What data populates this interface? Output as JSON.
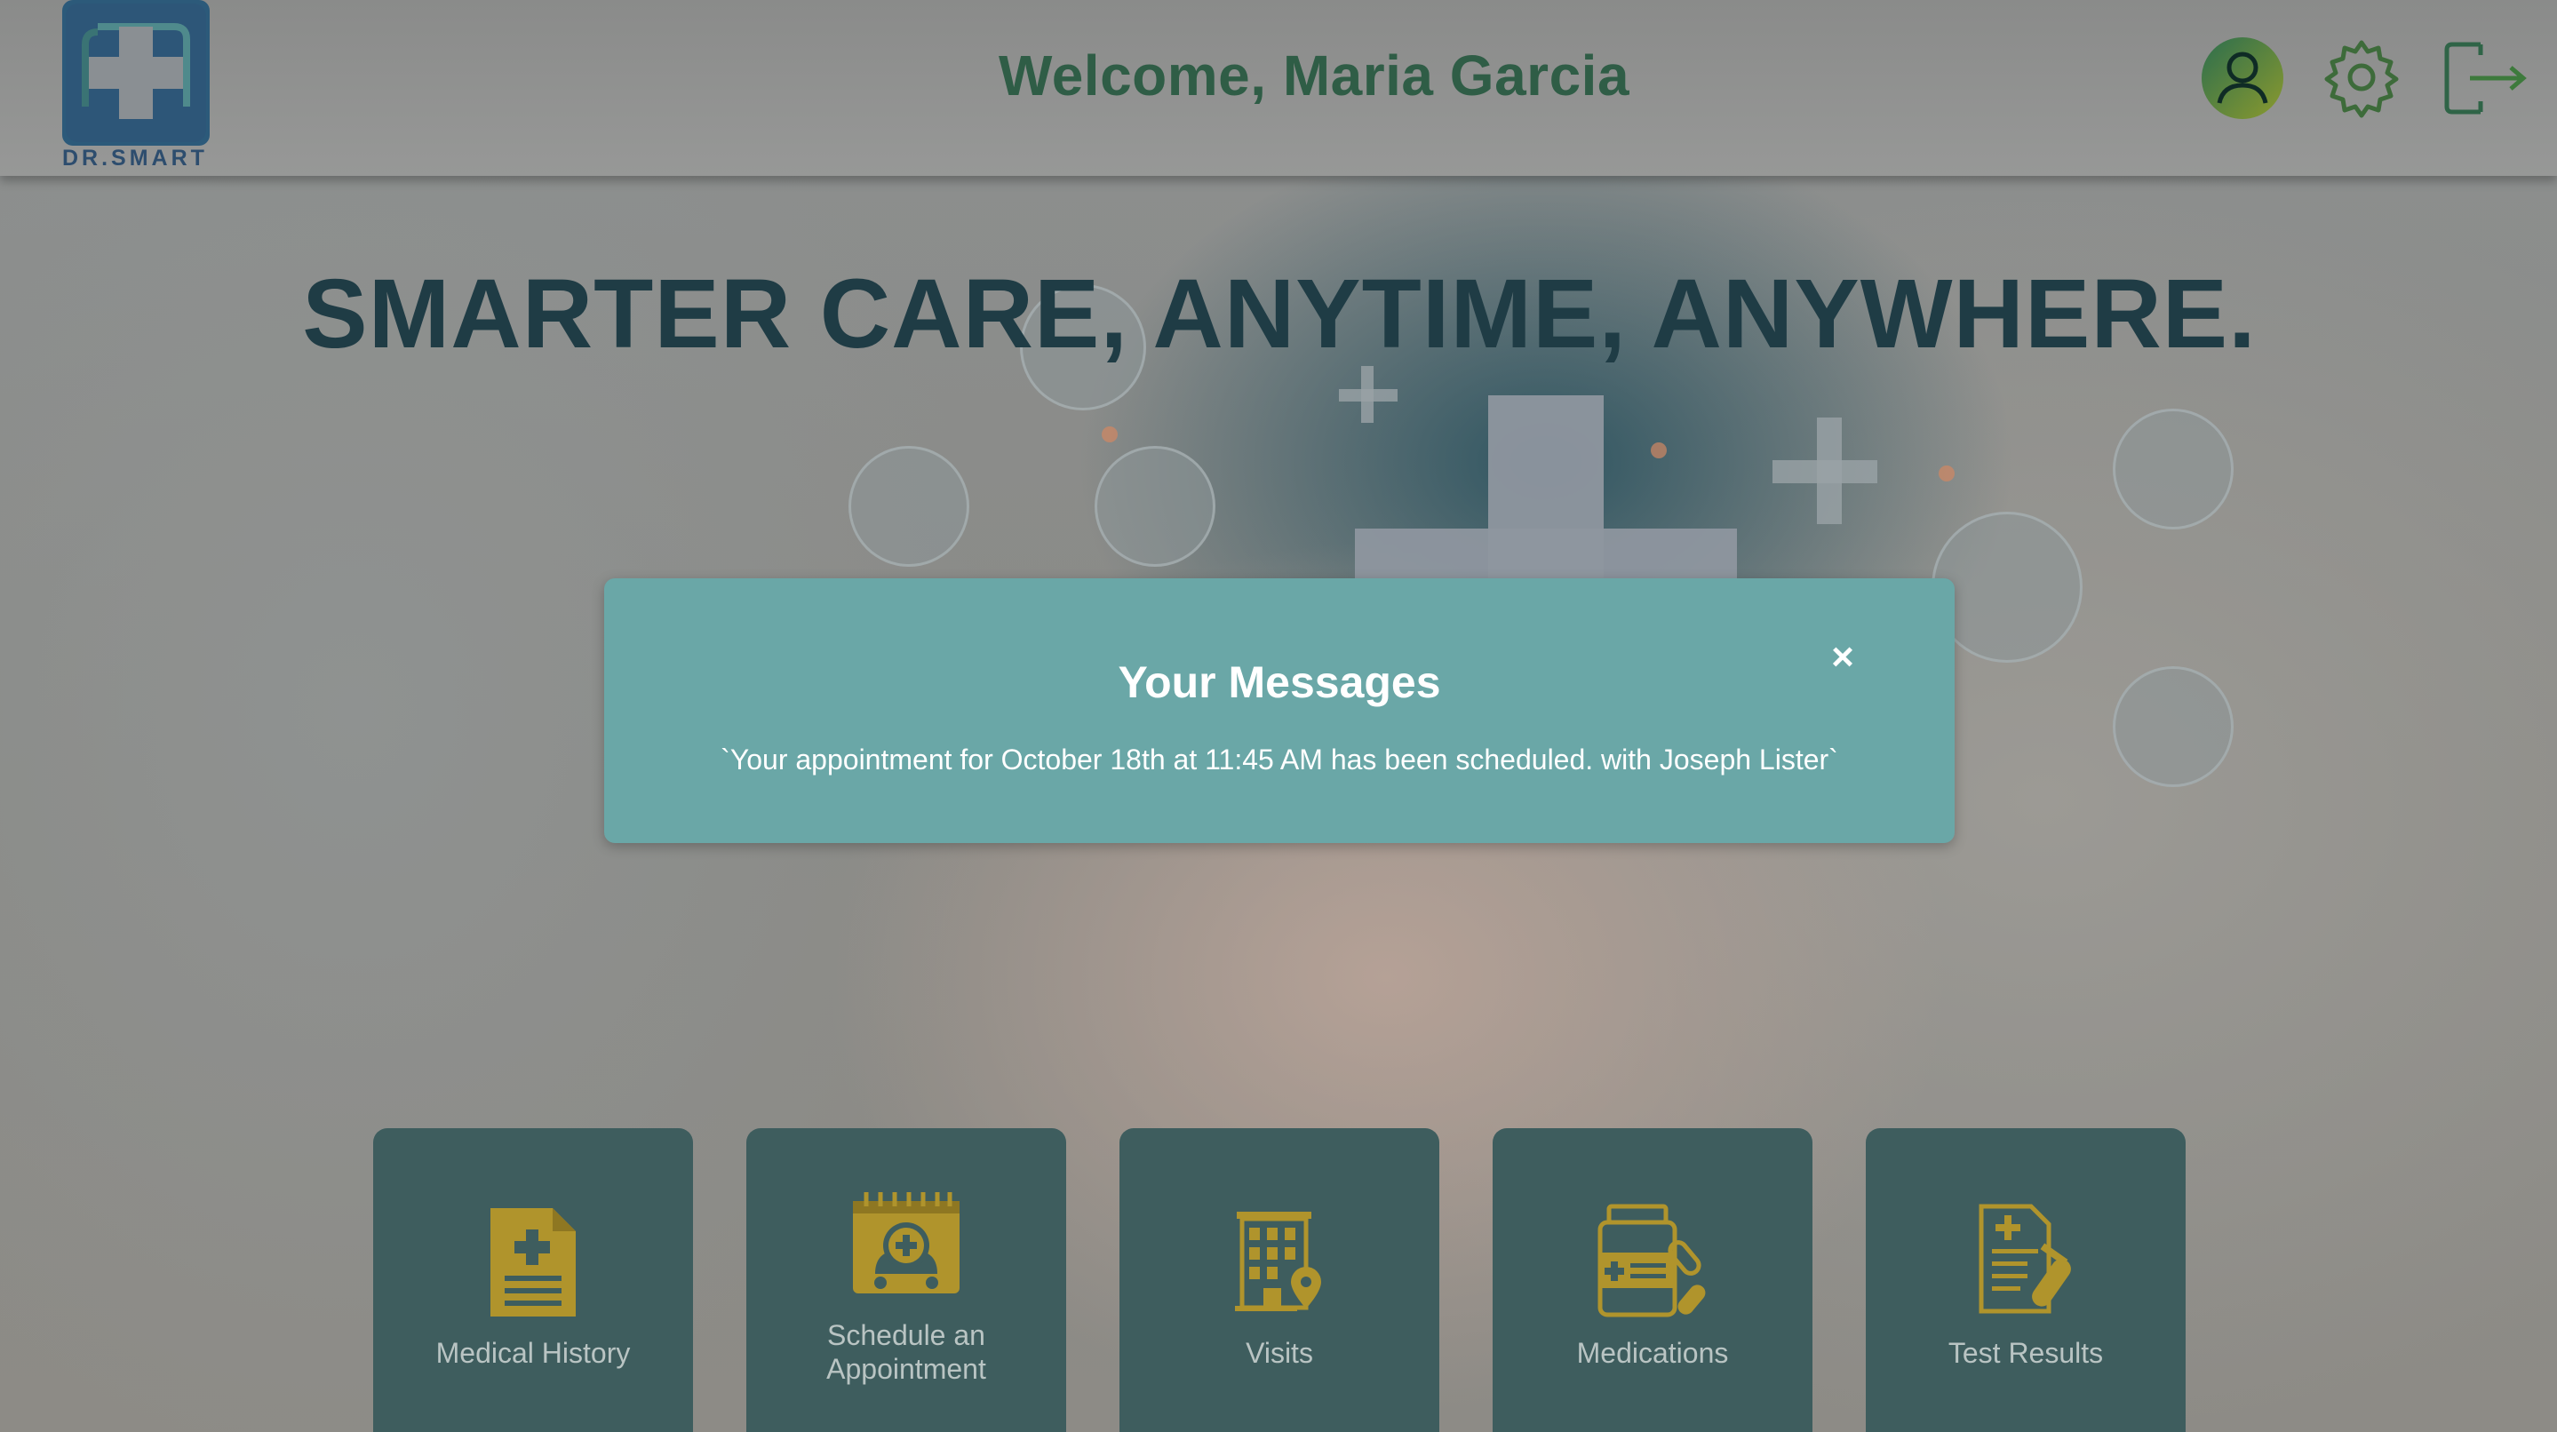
{
  "header": {
    "logo_text": "DR.SMART",
    "welcome": "Welcome, Maria Garcia",
    "icons": [
      "user-avatar-icon",
      "gear-icon",
      "logout-icon"
    ]
  },
  "hero": {
    "tagline": "SMARTER CARE, ANYTIME, ANYWHERE."
  },
  "modal": {
    "title": "Your Messages",
    "message": "`Your appointment for October 18th at 11:45 AM has been scheduled. with Joseph Lister`",
    "close_label": "×"
  },
  "cards": [
    {
      "label": "Medical History",
      "icon": "document-icon"
    },
    {
      "label": "Schedule an Appointment",
      "line1": "Schedule an",
      "line2": "Appointment",
      "icon": "calendar-icon"
    },
    {
      "label": "Visits",
      "icon": "hospital-building-icon"
    },
    {
      "label": "Medications",
      "icon": "medication-bottle-icon"
    },
    {
      "label": "Test Results",
      "icon": "test-results-icon"
    }
  ],
  "colors": {
    "accent_teal": "#6aa7a7",
    "card_bg": "#3e5d5e",
    "icon_gold": "#b0942c",
    "header_green": "#2f5d46"
  }
}
